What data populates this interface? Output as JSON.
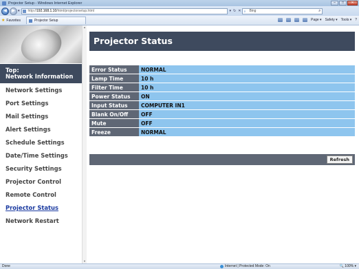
{
  "browser": {
    "window_title": "Projector Setup - Windows Internet Explorer",
    "window_buttons": {
      "minimize": "–",
      "maximize": "□",
      "close": "✕"
    },
    "url_prefix": "http://",
    "url_host": "192.168.1.10",
    "url_path": "/html/projectorsetup.html",
    "search_text": "Bing",
    "favorites_label": "Favorites",
    "tab_title": "Projector Setup",
    "commands": {
      "page": "Page ▾",
      "safety": "Safety ▾",
      "tools": "Tools ▾",
      "help": "?"
    },
    "icons": [
      "back-icon",
      "forward-icon",
      "refresh-icon",
      "stop-icon",
      "search-icon",
      "star-icon",
      "home-icon",
      "feeds-icon",
      "print-icon"
    ]
  },
  "sidebar": {
    "top_item": {
      "line1": "Top:",
      "line2": "Network Information"
    },
    "items": [
      {
        "label": "Network Settings"
      },
      {
        "label": "Port Settings"
      },
      {
        "label": "Mail Settings"
      },
      {
        "label": "Alert Settings"
      },
      {
        "label": "Schedule Settings"
      },
      {
        "label": "Date/Time Settings"
      },
      {
        "label": "Security Settings"
      },
      {
        "label": "Projector Control"
      },
      {
        "label": "Remote Control"
      },
      {
        "label": "Projector Status"
      },
      {
        "label": "Network Restart"
      }
    ],
    "active_item": "Projector Status"
  },
  "main": {
    "title": "Projector Status",
    "status_rows": [
      {
        "label": "Error Status",
        "value": "NORMAL"
      },
      {
        "label": "Lamp Time",
        "value": "10 h"
      },
      {
        "label": "Filter Time",
        "value": "10 h"
      },
      {
        "label": "Power Status",
        "value": "ON"
      },
      {
        "label": "Input Status",
        "value": "COMPUTER IN1"
      },
      {
        "label": "Blank On/Off",
        "value": "OFF"
      },
      {
        "label": "Mute",
        "value": "OFF"
      },
      {
        "label": "Freeze",
        "value": "NORMAL"
      }
    ],
    "refresh_label": "Refresh"
  },
  "statusbar": {
    "left": "Done",
    "zone": "Internet | Protected Mode: On",
    "zoom": "100%"
  },
  "colors": {
    "header_bg": "#3e4a5e",
    "label_bg": "#5f6775",
    "value_bg": "#8ec5ee",
    "active_link": "#1a3aa0"
  }
}
